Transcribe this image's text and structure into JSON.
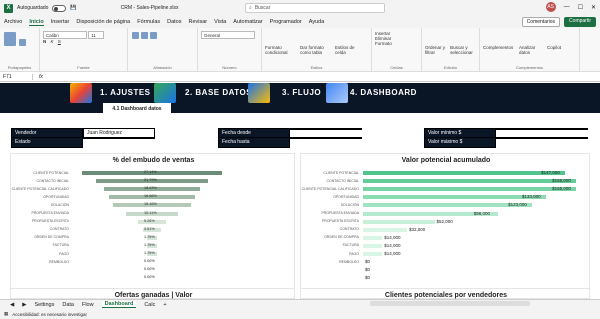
{
  "titlebar": {
    "app": "Archivo",
    "autosave": "Autoguardado",
    "filename": "CRM - Sales-Pipeline.xlsx",
    "search": "Buscar",
    "user": "AS"
  },
  "menu": {
    "items": [
      "Archivo",
      "Inicio",
      "Insertar",
      "Disposición de página",
      "Fórmulas",
      "Datos",
      "Revisar",
      "Vista",
      "Automatizar",
      "Programador",
      "Ayuda"
    ],
    "comments": "Comentarios",
    "share": "Compartir"
  },
  "ribbon": {
    "font": "Calibri",
    "size": "11",
    "format": "General",
    "groups": [
      "Portapapeles",
      "Fuente",
      "Alineación",
      "Número",
      "Estilos",
      "Celdas",
      "Edición",
      "Complementos"
    ],
    "btn_format": "Formato condicional",
    "btn_table": "Dar formato como tabla",
    "btn_styles": "Estilos de celda",
    "btn_insert": "Insertar",
    "btn_delete": "Eliminar",
    "btn_formatcell": "Formato",
    "btn_sort": "Ordenar y filtrar",
    "btn_find": "Buscar y seleccionar",
    "btn_addins": "Complementos",
    "btn_analyze": "Analizar datos",
    "btn_copilot": "Copilot"
  },
  "formula": {
    "cell": "F71",
    "fx": "fx"
  },
  "banner": {
    "s1": "1. AJUSTES",
    "s2": "2. BASE DATOS",
    "s3": "3. FLUJO",
    "s4": "4. DASHBOARD",
    "tab": "4.1 Dashboard datos"
  },
  "filters": {
    "vendedor": "Vendedor",
    "vendedor_val": "Juan Rodriguez",
    "estado": "Estado",
    "fecha_desde": "Fecha desde",
    "fecha_hasta": "Fecha hasta",
    "valor_min": "Valor mínimo $",
    "valor_max": "Valor máximo $"
  },
  "funnel": {
    "title": "% del embudo de ventas",
    "labels": [
      "CLIENTE POTENCIAL",
      "CONTACTO INICIAL",
      "CLIENTE POTENCIAL CALIFICADO",
      "OPORTUNIDAD",
      "SOLUCIÓN",
      "PROPUESTA ENVIADA",
      "PROPUESTA ESCRITA",
      "CONTRATO",
      "ORDEN DE COMPRA",
      "FACTURA",
      "PAGO",
      "REMBOLSO",
      "",
      ""
    ],
    "values": [
      "27.14%",
      "21.79%",
      "18.63%",
      "16.66%",
      "15.16%",
      "10.11%",
      "5.26%",
      "3.51%",
      "1.75%",
      "1.75%",
      "1.75%",
      "0.00%",
      "0.00%",
      "0.00%"
    ],
    "pct": [
      27.14,
      21.79,
      18.63,
      16.66,
      15.16,
      10.11,
      5.26,
      3.51,
      1.75,
      1.75,
      1.75,
      0,
      0,
      0
    ]
  },
  "cumval": {
    "title": "Valor potencial acumulado",
    "labels": [
      "CLIENTE POTENCIAL",
      "CONTACTO INICIAL",
      "CLIENTE POTENCIAL CALIFICADO",
      "OPORTUNIDAD",
      "SOLUCIÓN",
      "PROPUESTA ENVIADA",
      "PROPUESTA ESCRITA",
      "CONTRATO",
      "ORDEN DE COMPRA",
      "FACTURA",
      "PAGO",
      "REMBOLSO",
      "",
      ""
    ],
    "values": [
      "$147,000",
      "$155,000",
      "$155,000",
      "$133,000",
      "$123,000",
      "$98,000",
      "$52,000",
      "$32,000",
      "$14,000",
      "$14,000",
      "$14,000",
      "$0",
      "$0",
      "$0"
    ],
    "nums": [
      147000,
      155000,
      155000,
      133000,
      123000,
      98000,
      52000,
      32000,
      14000,
      14000,
      14000,
      0,
      0,
      0
    ]
  },
  "lower": {
    "left": "Ofertas ganadas | Valor",
    "right": "Clientes potenciales por vendedores"
  },
  "tabs": [
    "Settings",
    "Data",
    "Flow",
    "Dashboard",
    "Calc"
  ],
  "status": "Accesibilidad: es necesario investigar"
}
